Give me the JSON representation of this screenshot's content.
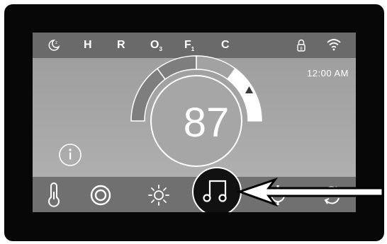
{
  "status_bar": {
    "mode_labels": [
      {
        "main": "H",
        "sub": ""
      },
      {
        "main": "R",
        "sub": ""
      },
      {
        "main": "O",
        "sub": "3"
      },
      {
        "main": "F",
        "sub": "1"
      },
      {
        "main": "C",
        "sub": ""
      }
    ],
    "icons": [
      "moon-sleep-icon",
      "lock-icon",
      "wifi-icon"
    ]
  },
  "clock": {
    "time": "12:00 AM"
  },
  "dial": {
    "temperature": "87"
  },
  "nav": {
    "items": [
      "thermometer-icon",
      "target-icon",
      "sun-icon",
      "music-icon",
      "gear-icon",
      "swap-icon"
    ],
    "selected": "music-icon"
  },
  "colors": {
    "screen": "#a4a4a4",
    "status_bar": "#6a6a6a",
    "nav_bar": "#707070",
    "selected": "#111111"
  }
}
